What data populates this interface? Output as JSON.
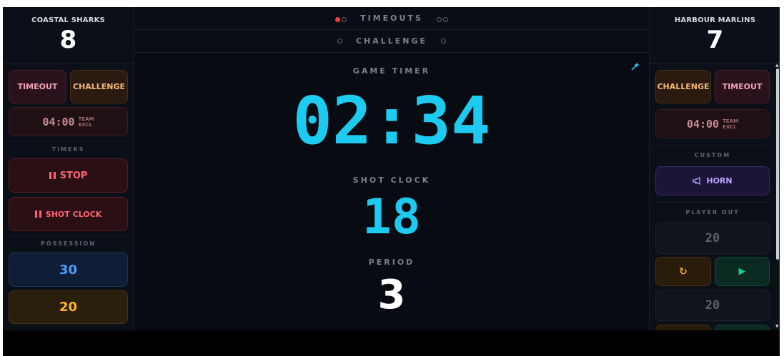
{
  "home": {
    "name": "COASTAL SHARKS",
    "score": "8",
    "timeout_label": "TIMEOUT",
    "challenge_label": "CHALLENGE",
    "excl_time": "04:00",
    "excl_label_1": "TEAM",
    "excl_label_2": "EXCL",
    "timers_label": "TIMERS",
    "stop_label": "STOP",
    "shot_clock_label": "SHOT CLOCK",
    "possession_label": "POSSESSION",
    "poss_30": "30",
    "poss_20": "20"
  },
  "away": {
    "name": "HARBOUR MARLINS",
    "score": "7",
    "challenge_label": "CHALLENGE",
    "timeout_label": "TIMEOUT",
    "excl_time": "04:00",
    "excl_label_1": "TEAM",
    "excl_label_2": "EXCL",
    "custom_label": "CUSTOM",
    "horn_label": "HORN",
    "player_out_label": "PLAYER OUT",
    "player_out_1": "20",
    "player_out_2": "20",
    "reset_icon": "↻",
    "play_icon": "▶"
  },
  "center": {
    "timeouts_label": "TIMEOUTS",
    "challenge_label": "CHALLENGE",
    "game_timer_label": "GAME TIMER",
    "game_timer": "02:34",
    "shot_clock_label": "SHOT CLOCK",
    "shot_clock": "18",
    "period_label": "PERIOD",
    "period": "3"
  },
  "colors": {
    "timer_cyan": "#1ecbf0",
    "timeout_used": "#ff3b3b"
  },
  "icons": {
    "settings": "sparkle-wand-icon",
    "horn": "megaphone-icon",
    "pause": "pause-icon"
  }
}
